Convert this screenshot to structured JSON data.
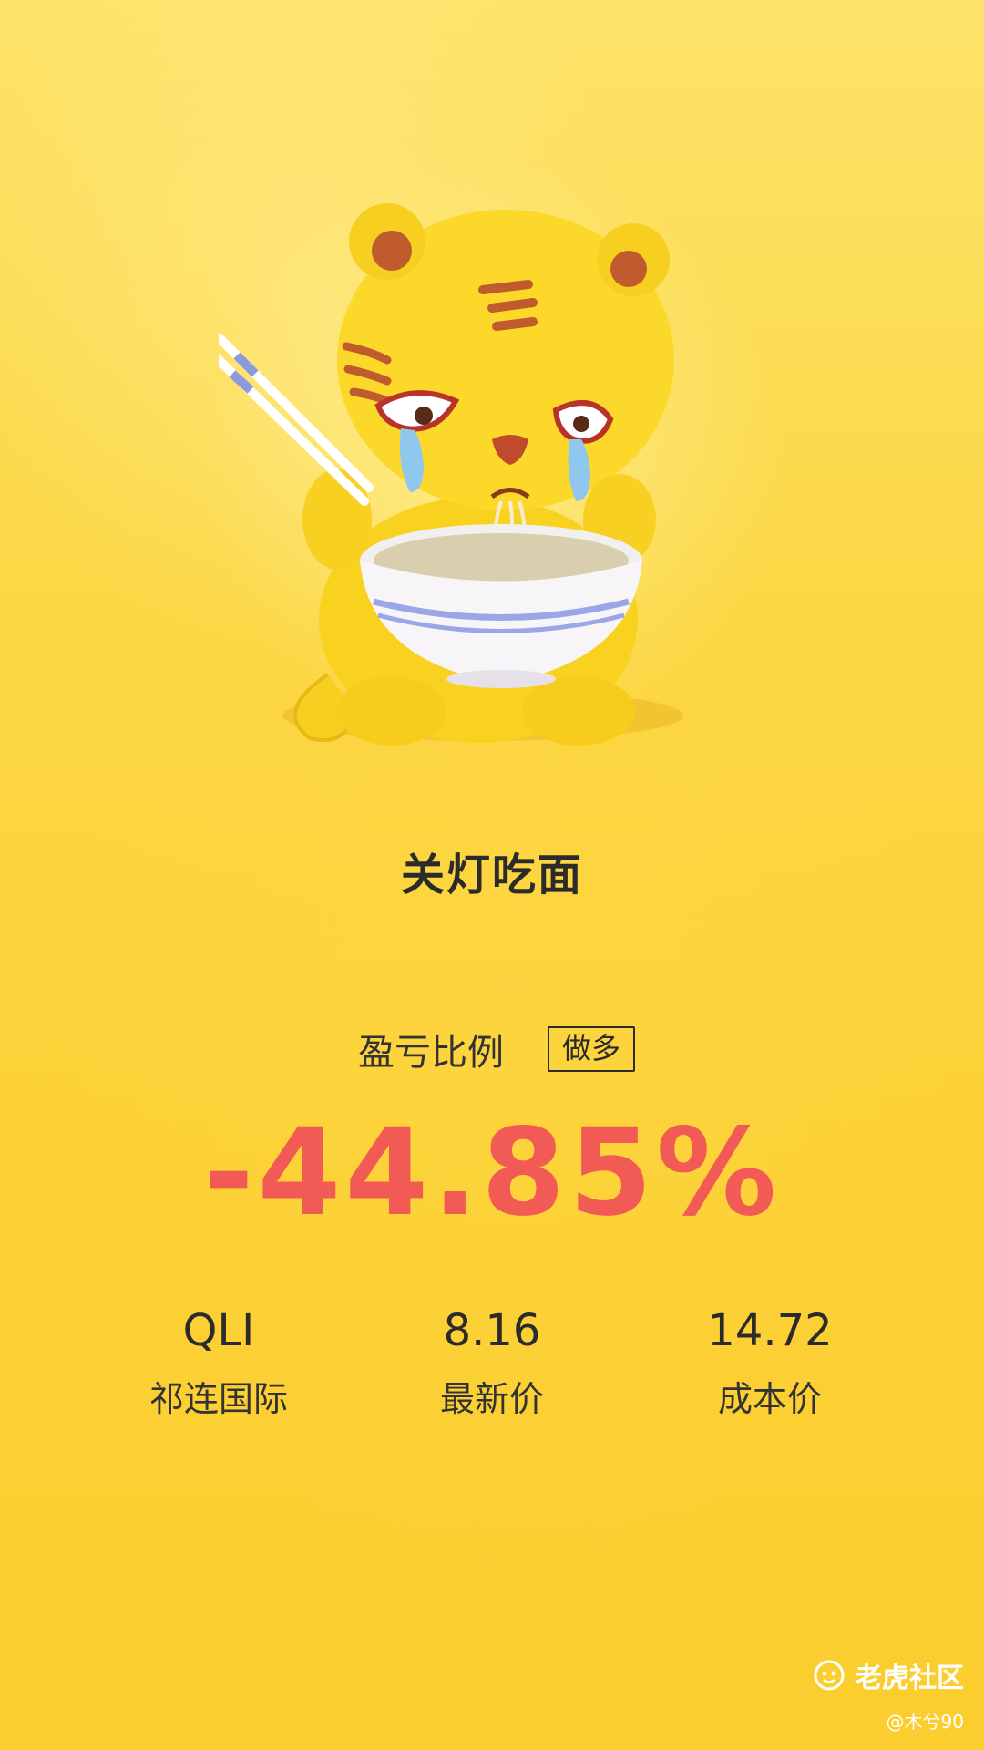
{
  "headline": "关灯吃面",
  "ratio": {
    "label": "盈亏比例",
    "badge": "做多",
    "value": "-44.85%"
  },
  "stats": [
    {
      "value": "QLI",
      "label": "祁连国际"
    },
    {
      "value": "8.16",
      "label": "最新价"
    },
    {
      "value": "14.72",
      "label": "成本价"
    }
  ],
  "watermark": {
    "brand": "老虎社区",
    "user": "@木兮90"
  },
  "colors": {
    "background": "#fccf2f",
    "loss": "#f25a55",
    "text": "#2b2b2b"
  }
}
